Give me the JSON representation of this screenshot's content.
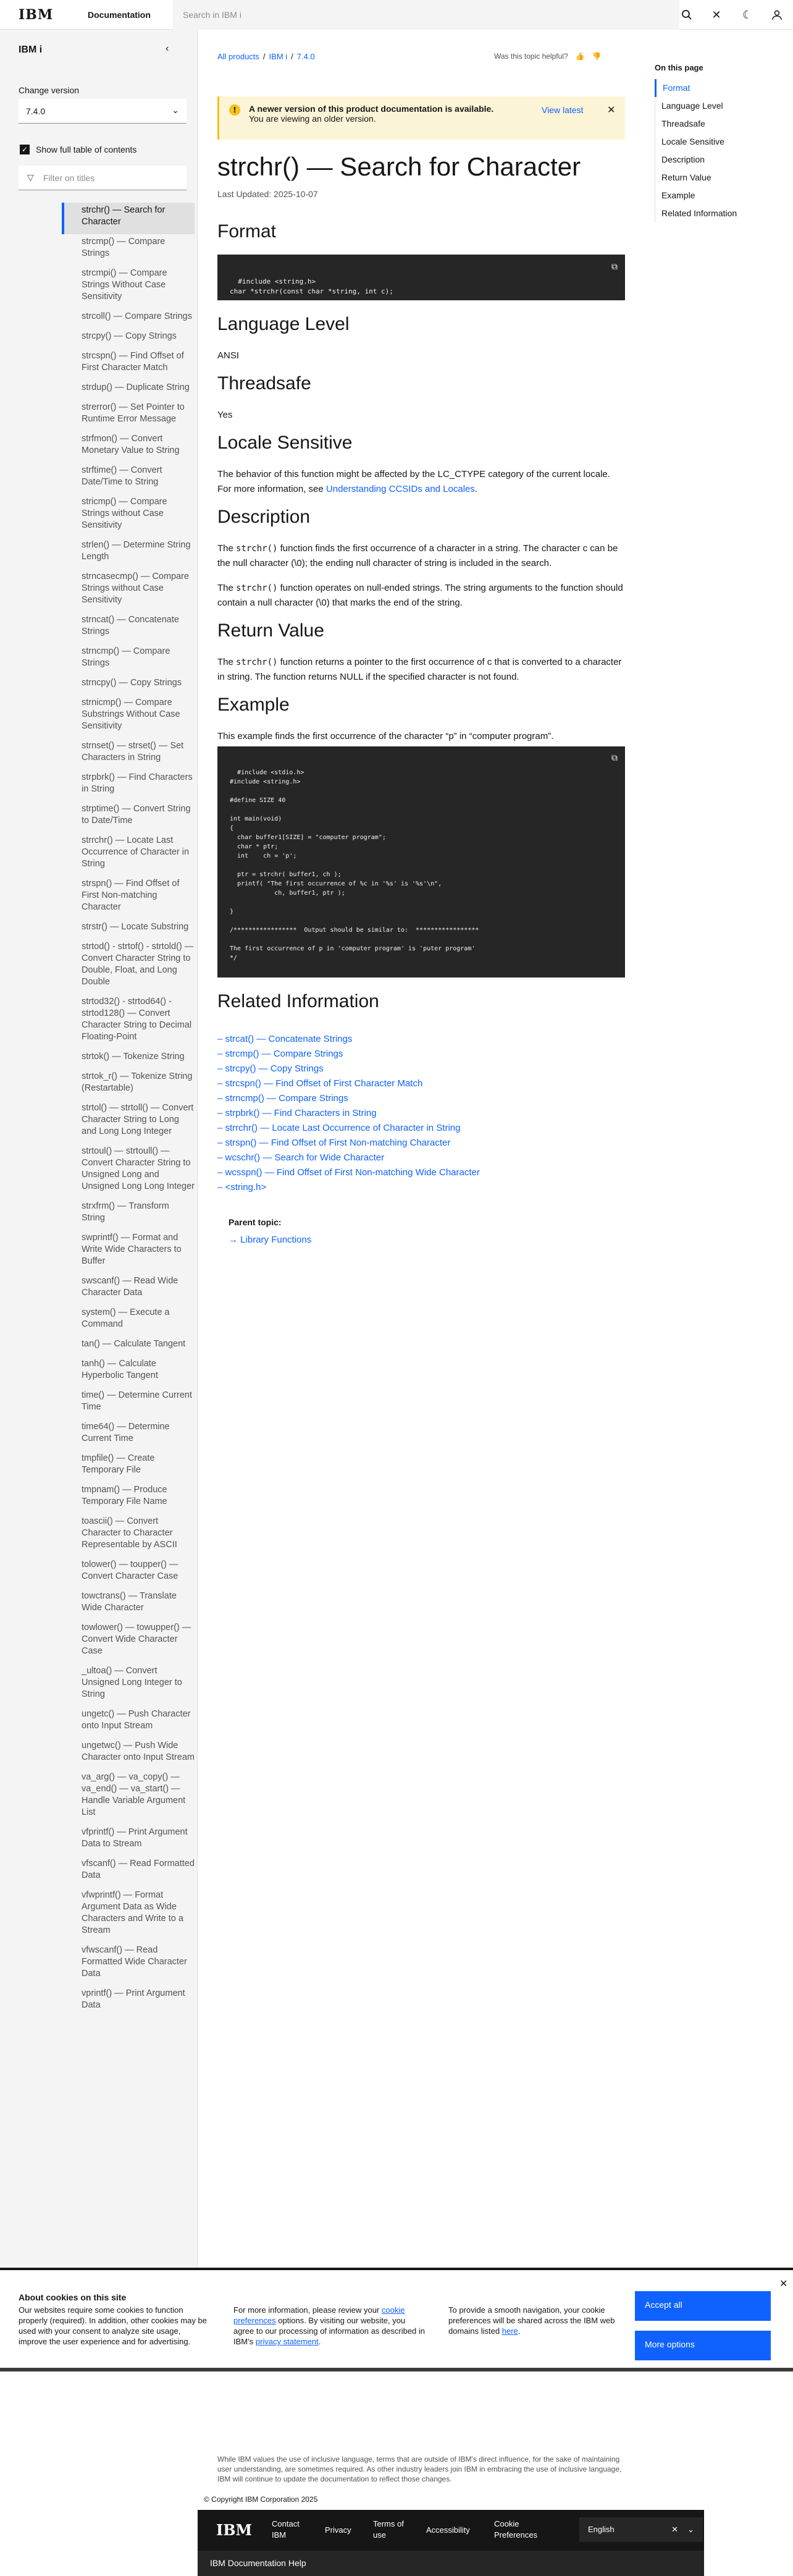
{
  "header": {
    "logo": "IBM",
    "docs": "Documentation",
    "search_placeholder": "Search in IBM i"
  },
  "sidebar": {
    "title": "IBM i",
    "change_version_label": "Change version",
    "version": "7.4.0",
    "show_toc_label": "Show full table of contents",
    "filter_placeholder": "Filter on titles",
    "items": [
      "strchr() — Search for Character",
      "strcmp() — Compare Strings",
      "strcmpi() — Compare Strings Without Case Sensitivity",
      "strcoll() — Compare Strings",
      "strcpy() — Copy Strings",
      "strcspn() — Find Offset of First Character Match",
      "strdup() — Duplicate String",
      "strerror() — Set Pointer to Runtime Error Message",
      "strfmon() — Convert Monetary Value to String",
      "strftime() — Convert Date/Time to String",
      "stricmp() — Compare Strings without Case Sensitivity",
      "strlen() — Determine String Length",
      "strncasecmp() — Compare Strings without Case Sensitivity",
      "strncat() — Concatenate Strings",
      "strncmp() — Compare Strings",
      "strncpy() — Copy Strings",
      "strnicmp() — Compare Substrings Without Case Sensitivity",
      "strnset() — strset() — Set Characters in String",
      "strpbrk() — Find Characters in String",
      "strptime() — Convert String to Date/Time",
      "strrchr() — Locate Last Occurrence of Character in String",
      "strspn() — Find Offset of First Non-matching Character",
      "strstr() — Locate Substring",
      "strtod() - strtof() - strtold() — Convert Character String to Double, Float, and Long Double",
      "strtod32() - strtod64() - strtod128() — Convert Character String to Decimal Floating-Point",
      "strtok() — Tokenize String",
      "strtok_r() — Tokenize String (Restartable)",
      "strtol() — strtoll() — Convert Character String to Long and Long Long Integer",
      "strtoul() — strtoull() — Convert Character String to Unsigned Long and Unsigned Long Long Integer",
      "strxfrm() — Transform String",
      "swprintf() — Format and Write Wide Characters to Buffer",
      "swscanf() — Read Wide Character Data",
      "system() — Execute a Command",
      "tan() — Calculate Tangent",
      "tanh() — Calculate Hyperbolic Tangent",
      "time() — Determine Current Time",
      "time64() — Determine Current Time",
      "tmpfile() — Create Temporary File",
      "tmpnam() — Produce Temporary File Name",
      "toascii() — Convert Character to Character Representable by ASCII",
      "tolower() — toupper() — Convert Character Case",
      "towctrans() — Translate Wide Character",
      "towlower() — towupper() — Convert Wide Character Case",
      "_ultoa() — Convert Unsigned Long Integer to String",
      "ungetc() — Push Character onto Input Stream",
      "ungetwc() — Push Wide Character onto Input Stream",
      "va_arg() — va_copy() — va_end() — va_start() — Handle Variable Argument List",
      "vfprintf() — Print Argument Data to Stream",
      "vfscanf() — Read Formatted Data",
      "vfwprintf() — Format Argument Data as Wide Characters and Write to a Stream",
      "vfwscanf() — Read Formatted Wide Character Data",
      "vprintf() — Print Argument Data"
    ]
  },
  "breadcrumb": [
    "All products",
    "IBM i",
    "7.4.0"
  ],
  "helpful_label": "Was this topic helpful?",
  "notice": {
    "title": "A newer version of this product documentation is available.",
    "text": "You are viewing an older version.",
    "link": "View latest"
  },
  "page": {
    "title": "strchr() — Search for Character",
    "updated": "Last Updated: 2025-10-07",
    "h_format": "Format",
    "format_code": "#include <string.h>\nchar *strchr(const char *string, int c);",
    "h_level": "Language Level",
    "level": "ANSI",
    "h_thread": "Threadsafe",
    "thread": "Yes",
    "h_locale": "Locale Sensitive",
    "locale_text": "The behavior of this function might be affected by the LC_CTYPE category of the current locale. For more information, see",
    "locale_link": "Understanding CCSIDs and Locales",
    "h_desc": "Description",
    "desc_code1": "strchr()",
    "desc1": "function finds the first occurrence of a character in a string. The character c can be the null character (\\0); the ending null character of string is included in the search.",
    "desc2": "function operates on null-ended strings. The string arguments to the function should contain a null character (\\0) that marks the end of the string.",
    "h_return": "Return Value",
    "return_text": "function returns a pointer to the first occurrence of c that is converted to a character in string. The function returns NULL if the specified character is not found.",
    "word_the": "The",
    "h_example": "Example",
    "example_intro": "This example finds the first occurrence of the character “p” in “computer program”.",
    "example_code": "#include <stdio.h>\n#include <string.h>\n\n#define SIZE 40\n\nint main(void)\n{\n  char buffer1[SIZE] = \"computer program\";\n  char * ptr;\n  int    ch = 'p';\n\n  ptr = strchr( buffer1, ch );\n  printf( \"The first occurrence of %c in '%s' is '%s'\\n\",\n            ch, buffer1, ptr );\n\n}\n\n/*****************  Output should be similar to:  *****************\n\nThe first occurrence of p in 'computer program' is 'puter program'\n*/",
    "h_related": "Related Information",
    "related": [
      "strcat() — Concatenate Strings",
      "strcmp() — Compare Strings",
      "strcpy() — Copy Strings",
      "strcspn() — Find Offset of First Character Match",
      "strncmp() — Compare Strings",
      "strpbrk() — Find Characters in String",
      "strrchr() — Locate Last Occurrence of Character in String",
      "strspn() — Find Offset of First Non-matching Character",
      "wcschr() — Search for Wide Character",
      "wcsspn() — Find Offset of First Non-matching Wide Character",
      "<string.h>"
    ],
    "parent_label": "Parent topic:",
    "parent_link": "Library Functions"
  },
  "on_this_page": {
    "title": "On this page",
    "items": [
      "Format",
      "Language Level",
      "Threadsafe",
      "Locale Sensitive",
      "Description",
      "Return Value",
      "Example",
      "Related Information"
    ]
  },
  "cookie": {
    "title": "About cookies on this site",
    "col1": "Our websites require some cookies to function properly (required). In addition, other cookies may be used with your consent to analyze site usage, improve the user experience and for advertising.",
    "col2a": "For more information, please review your",
    "col2_link1": "cookie preferences",
    "col2b": "options. By visiting our website, you agree to our processing of information as described in IBM’s",
    "col2_link2": "privacy statement",
    "col3a": "To provide a smooth navigation, your cookie preferences will be shared across the IBM web domains listed",
    "col3_link": "here",
    "accept": "Accept all",
    "more": "More options"
  },
  "footer": {
    "note": "While IBM values the use of inclusive language, terms that are outside of IBM's direct influence, for the sake of maintaining user understanding, are sometimes required. As other industry leaders join IBM in embracing the use of inclusive language, IBM will continue to update the documentation to reflect those changes.",
    "copyright": "© Copyright IBM Corporation 2025",
    "logo": "IBM",
    "links": [
      "Contact IBM",
      "Privacy",
      "Terms of use",
      "Accessibility",
      "Cookie Preferences"
    ],
    "language": "English",
    "help": "IBM Documentation Help"
  }
}
